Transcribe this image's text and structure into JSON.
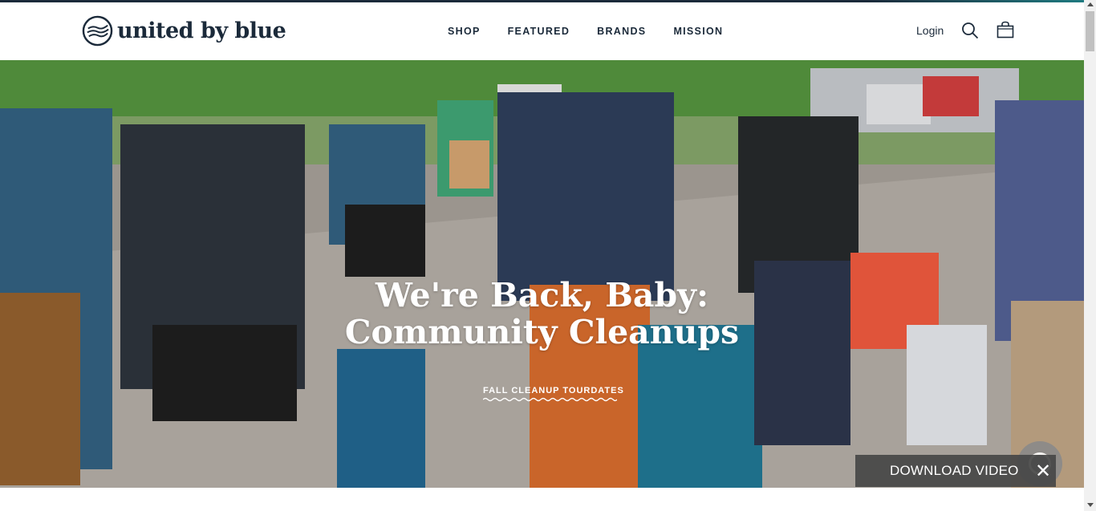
{
  "brand": {
    "name": "united by blue",
    "logo_icon": "wave-circle-logo"
  },
  "nav": {
    "items": [
      {
        "label": "SHOP"
      },
      {
        "label": "FEATURED"
      },
      {
        "label": "BRANDS"
      },
      {
        "label": "MISSION"
      }
    ]
  },
  "header_actions": {
    "login_label": "Login",
    "search_icon": "search-icon",
    "cart_icon": "shopping-bag-icon"
  },
  "hero": {
    "title_line1": "We're Back, Baby:",
    "title_line2": "Community Cleanups",
    "cta_label": "FALL CLEANUP TOURDATES"
  },
  "overlay": {
    "download_label": "DOWNLOAD VIDEO",
    "close_glyph": "✕"
  },
  "colors": {
    "brand_navy": "#1b2a3a",
    "accent_teal": "#1f7a80"
  }
}
